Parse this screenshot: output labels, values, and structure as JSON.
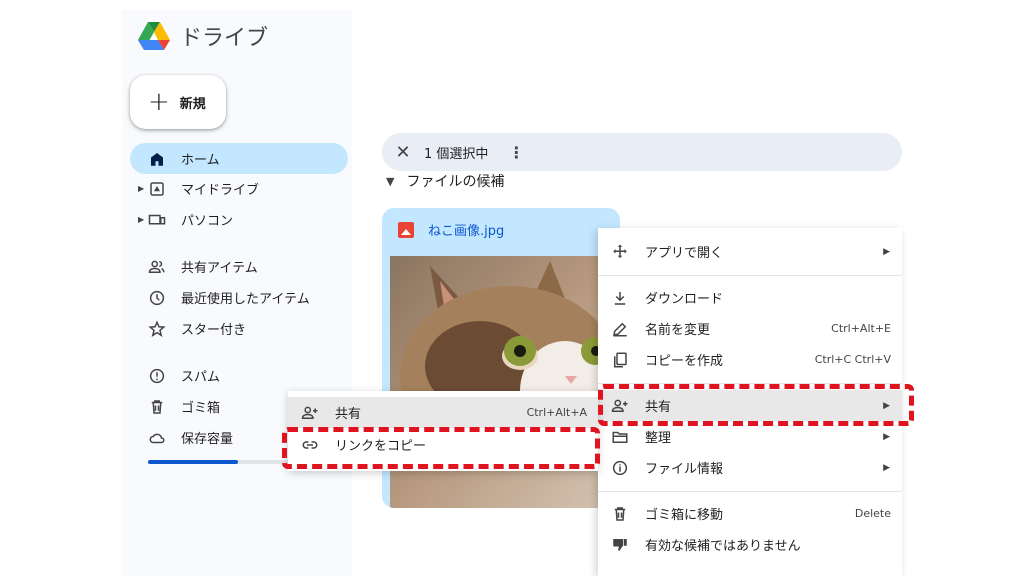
{
  "sidebar": {
    "app_title": "ドライブ",
    "new_label": "新規",
    "items": [
      {
        "label": "ホーム"
      },
      {
        "label": "マイドライブ"
      },
      {
        "label": "パソコン"
      },
      {
        "label": "共有アイテム"
      },
      {
        "label": "最近使用したアイテム"
      },
      {
        "label": "スター付き"
      },
      {
        "label": "スパム"
      },
      {
        "label": "ゴミ箱"
      },
      {
        "label": "保存容量"
      }
    ],
    "storage_used_fraction": 0.56
  },
  "toolbar": {
    "selection_label": "1 個選択中"
  },
  "main": {
    "section_title": "ファイルの候補",
    "file_name": "ねこ画像.jpg"
  },
  "context_menu": {
    "items": [
      {
        "label": "アプリで開く",
        "shortcut": ""
      },
      {
        "label": "ダウンロード",
        "shortcut": ""
      },
      {
        "label": "名前を変更",
        "shortcut": "Ctrl+Alt+E"
      },
      {
        "label": "コピーを作成",
        "shortcut": "Ctrl+C Ctrl+V"
      },
      {
        "label": "共有",
        "shortcut": ""
      },
      {
        "label": "整理",
        "shortcut": ""
      },
      {
        "label": "ファイル情報",
        "shortcut": ""
      },
      {
        "label": "ゴミ箱に移動",
        "shortcut": "Delete"
      },
      {
        "label": "有効な候補ではありません",
        "shortcut": ""
      }
    ]
  },
  "share_submenu": {
    "items": [
      {
        "label": "共有",
        "shortcut": "Ctrl+Alt+A"
      },
      {
        "label": "リンクをコピー",
        "shortcut": ""
      }
    ]
  },
  "colors": {
    "accent": "#0b57d0",
    "active_nav": "#c2e7ff",
    "highlight_dash": "#e0141e"
  }
}
